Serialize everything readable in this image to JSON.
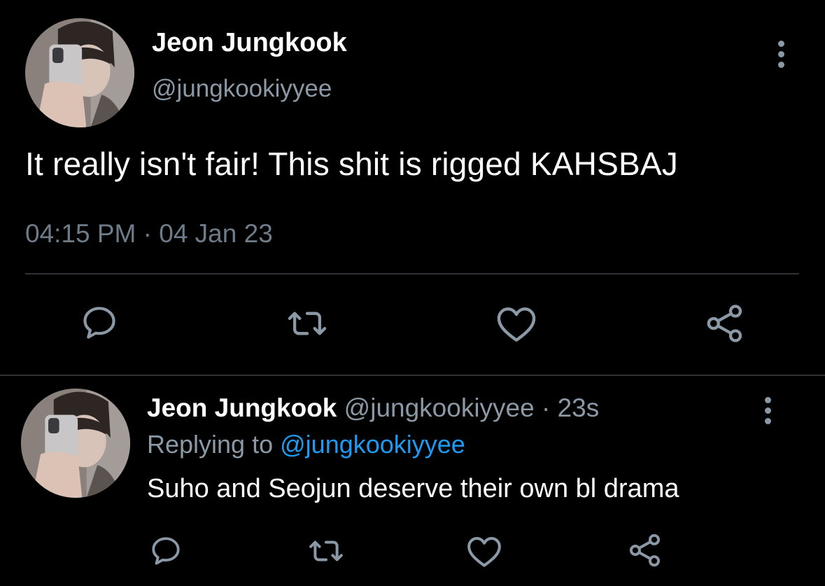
{
  "main_tweet": {
    "author": {
      "display_name": "Jeon Jungkook",
      "handle": "@jungkookiyyee"
    },
    "text": "It really isn't fair! This shit is rigged KAHSBAJ",
    "timestamp": "04:15 PM · 04 Jan 23",
    "actions": [
      "reply-icon",
      "retweet-icon",
      "like-icon",
      "share-icon"
    ]
  },
  "reply_tweet": {
    "author": {
      "display_name": "Jeon Jungkook",
      "handle": "@jungkookiyyee"
    },
    "separator": "·",
    "time_ago": "23s",
    "replying_to_label": "Replying to",
    "replying_to_handle": "@jungkookiyyee",
    "text": "Suho and Seojun deserve their own bl drama",
    "actions": [
      "reply-icon",
      "retweet-icon",
      "like-icon",
      "share-icon"
    ]
  },
  "colors": {
    "background": "#000000",
    "primary_text": "#ffffff",
    "secondary_text": "#8b98a5",
    "link": "#1d9bf0",
    "divider": "#2f3336",
    "icon": "#8b98a5"
  }
}
